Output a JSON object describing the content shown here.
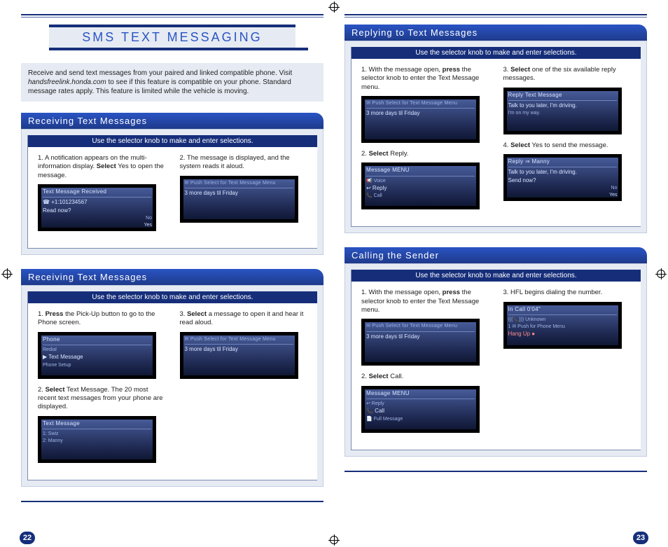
{
  "page_left_num": "22",
  "page_right_num": "23",
  "main_title": "SMS TEXT MESSAGING",
  "intro": {
    "line1": "Receive and send text messages from your paired and linked compatible phone. Visit ",
    "italic": "handsfreelink.honda.com",
    "line2": " to see if this feature is compatible on your phone. Standard message rates apply. This feature is limited while the vehicle is moving."
  },
  "left": {
    "sec1": {
      "title": "Receiving Text Messages",
      "instr": "Use the selector knob to make and enter selections.",
      "step1_a": "1.  A notification appears on the multi-information display.  ",
      "step1_b": "Select",
      "step1_c": " Yes to open the message.",
      "screen1": {
        "title": "Text Message Received",
        "line1": "☎ +1:101234567",
        "line2": "Read now?",
        "no": "No",
        "yes": "Yes"
      },
      "step2_a": "2.  The message is displayed, and the system reads it aloud.",
      "screen2": {
        "title": "✉ Push Select for Text Message Menu",
        "line1": "3 more days til Friday"
      }
    },
    "sec2": {
      "title": "Receiving Text Messages",
      "instr": "Use the selector knob to make and enter selections.",
      "step1_a": "1.  ",
      "step1_b": "Press",
      "step1_c": " the Pick-Up button to go to the Phone screen.",
      "screen1": {
        "title": "Phone",
        "line1": "Redial",
        "line2": "▶ Text Message",
        "line3": "Phone Setup"
      },
      "step2_a": "2.  ",
      "step2_b": "Select",
      "step2_c": " Text Message.  The 20 most recent text messages from your phone are displayed.",
      "screen2": {
        "title": "Text Message",
        "line1": "1: Swiz",
        "line2": "2: Manny"
      },
      "step3_a": "3.  ",
      "step3_b": "Select",
      "step3_c": " a message to open it and hear it read aloud.",
      "screen3": {
        "title": "✉ Push Select for Text Message Menu",
        "line1": "3 more days til Friday"
      }
    }
  },
  "right": {
    "sec1": {
      "title": "Replying to Text Messages",
      "instr": "Use the selector knob to make and enter selections.",
      "step1_a": "1.  With the message open, ",
      "step1_b": "press",
      "step1_c": " the selector knob to enter the Text Message menu.",
      "screen1": {
        "title": "✉ Push Select for Text Message Menu",
        "line1": "3 more days til Friday"
      },
      "step2_a": "2.  ",
      "step2_b": "Select",
      "step2_c": " Reply.",
      "screen2": {
        "title": "Message MENU",
        "line1": "📢 Voice",
        "line2": "↩ Reply",
        "line3": "📞 Call"
      },
      "step3_a": "3.  ",
      "step3_b": "Select",
      "step3_c": " one of the six available reply messages.",
      "screen3": {
        "title": "Reply Text Message",
        "line1": "Talk to you later, I'm driving.",
        "line2": "I'm on my way."
      },
      "step4_a": "4.  ",
      "step4_b": "Select",
      "step4_c": " Yes to send the message.",
      "screen4": {
        "title": "Reply ⇒ Manny",
        "line1": "Talk to you later, I'm driving.",
        "line2": "Send now?",
        "no": "No",
        "yes": "Yes"
      }
    },
    "sec2": {
      "title": "Calling the Sender",
      "instr": "Use the selector knob to make and enter selections.",
      "step1_a": "1.  With the message open, ",
      "step1_b": "press",
      "step1_c": " the selector knob to enter the Text Message menu.",
      "screen1": {
        "title": "✉ Push Select for Text Message Menu",
        "line1": "3 more days til Friday"
      },
      "step2_a": "2.  ",
      "step2_b": "Select",
      "step2_c": " Call.",
      "screen2": {
        "title": "Message MENU",
        "line1": "↩ Reply",
        "line2": "📞 Call",
        "line3": "📄 Full Message"
      },
      "step3_a": "3.  HFL begins dialing the number.",
      "screen3": {
        "title": "In Call             0'04\"",
        "line1": "(((📞)))   Unknown",
        "line2": "1 ✉ Push for Phone Menu",
        "line3": "Hang Up ●"
      }
    }
  }
}
